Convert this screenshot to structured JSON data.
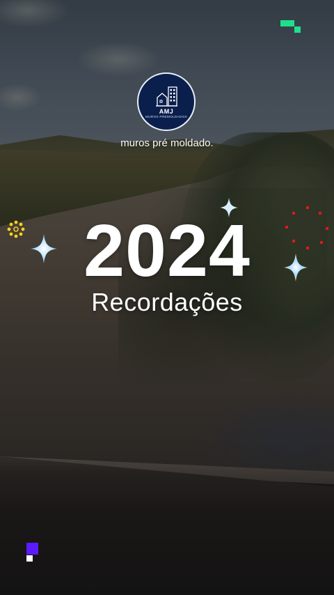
{
  "brand": {
    "logo_name": "AMJ",
    "logo_tagline": "MUROS PREMOLDADOS",
    "caption": "muros pré moldado."
  },
  "title": {
    "year": "2024",
    "subtitle": "Recordações"
  },
  "decorations": {
    "sparkle_icon": "four-point-star-icon",
    "sunburst_icon": "yellow-flower-icon",
    "pixel_icon": "pixel-block-icon",
    "colors": {
      "sparkle_center": "#ffffff",
      "sparkle_glow": "#8fd4ff",
      "sparkle_warm": "#ffd98a",
      "pixel_green": "#1ee08a",
      "pixel_purple": "#5b1bff",
      "firework_red": "#e01818",
      "sunburst_yellow": "#ffd21a",
      "logo_navy": "#0b1f4d"
    }
  }
}
